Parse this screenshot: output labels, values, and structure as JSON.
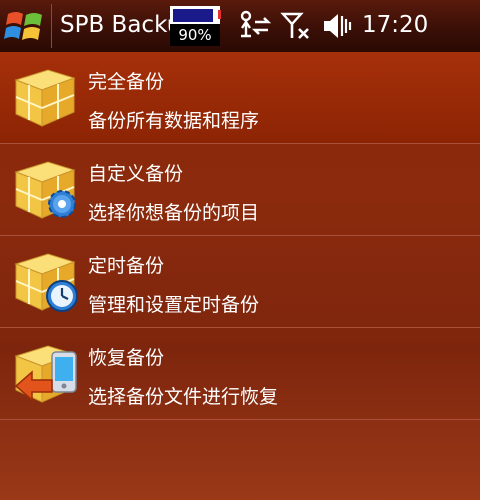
{
  "titlebar": {
    "app_title": "SPB Backup",
    "battery_percent": "90%",
    "battery_level": 0.9,
    "clock": "17:20",
    "icons": [
      "windows-start-icon",
      "sync-icon",
      "signal-no-service-icon",
      "speaker-muted-icon"
    ]
  },
  "menu": {
    "items": [
      {
        "title": "完全备份",
        "description": "备份所有数据和程序",
        "icon": "backup-box-icon",
        "selected": true
      },
      {
        "title": "自定义备份",
        "description": "选择你想备份的项目",
        "icon": "backup-box-gear-icon",
        "selected": false
      },
      {
        "title": "定时备份",
        "description": "管理和设置定时备份",
        "icon": "backup-box-clock-icon",
        "selected": false
      },
      {
        "title": "恢复备份",
        "description": "选择备份文件进行恢复",
        "icon": "backup-box-restore-icon",
        "selected": false
      }
    ]
  },
  "colors": {
    "background": "#8b2a0d",
    "selected_row": "#a6300a",
    "titlebar": "#3a0f06",
    "box_yellow": "#f5c94a",
    "gear_blue": "#2f7fd6",
    "restore_arrow": "#e2541c"
  }
}
